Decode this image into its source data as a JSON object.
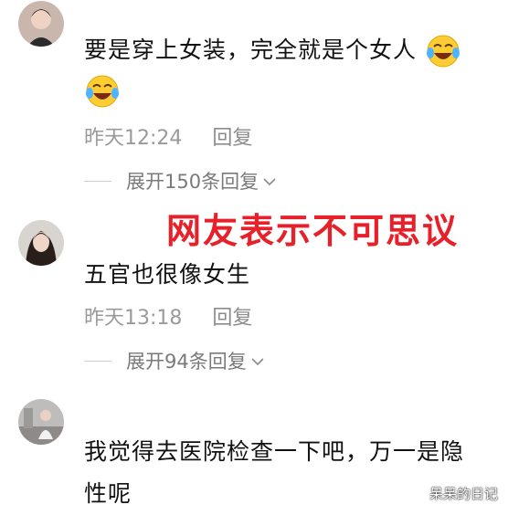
{
  "comments": [
    {
      "text_line1": "要是穿上女装，完全就是个女人",
      "time": "昨天12:24",
      "reply": "回复",
      "expand": "展开150条回复",
      "emoji_icon": "laughing-tears-icon"
    },
    {
      "text_line1": "五官也很像女生",
      "time": "昨天13:18",
      "reply": "回复",
      "expand": "展开94条回复"
    },
    {
      "text_line1": "我觉得去医院检查一下吧，万一是隐",
      "text_line2": "性呢"
    }
  ],
  "overlay_caption": "网友表示不可思议",
  "watermark": "呆呆的日记",
  "colors": {
    "overlay": "#e8202a",
    "meta": "#9a9a9a"
  }
}
